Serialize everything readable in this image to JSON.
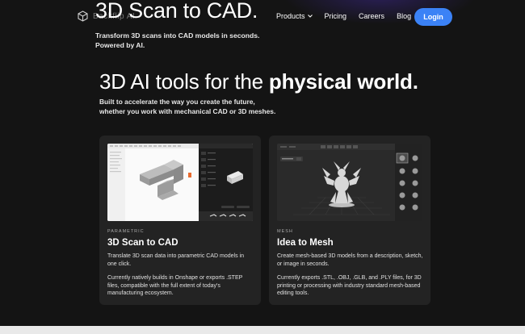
{
  "header": {
    "logo_text": "Backflip AI",
    "nav": [
      {
        "label": "Products"
      },
      {
        "label": "Pricing"
      },
      {
        "label": "Careers"
      },
      {
        "label": "Blog"
      }
    ],
    "login_label": "Login"
  },
  "hero": {
    "title": "3D Scan to CAD.",
    "subtitle": "Transform 3D scans into CAD models in seconds. Powered by AI."
  },
  "section": {
    "title_light": "3D AI tools for the ",
    "title_bold": "physical world.",
    "subtitle_line1": "Built to accelerate the way you create the future,",
    "subtitle_line2": "whether you work with mechanical CAD or 3D meshes."
  },
  "cards": [
    {
      "tag": "PARAMETRIC",
      "title": "3D Scan to CAD",
      "desc": "Translate 3D scan data into parametric CAD models in one click.",
      "desc2": "Currently natively builds in Onshape or exports .STEP files, compatible with the full extent of today's manufacturing ecosystem."
    },
    {
      "tag": "MESH",
      "title": "Idea to Mesh",
      "desc": "Create mesh-based 3D models from a description, sketch, or image in seconds.",
      "desc2": "Currently exports .STL, .OBJ, .GLB, and .PLY files, for 3D printing or processing with industry standard mesh-based editing tools."
    }
  ],
  "colors": {
    "background": "#141414",
    "card": "#232323",
    "accent": "#3b82f6"
  }
}
